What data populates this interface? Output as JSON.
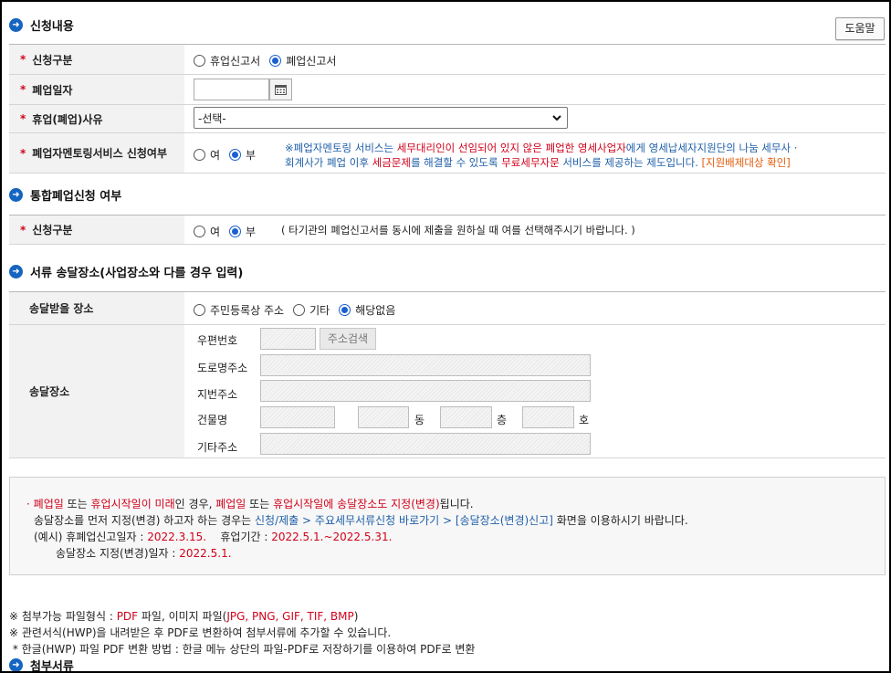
{
  "help_button": "도움말",
  "sections": {
    "application": "신청내용",
    "integrated": "통합폐업신청 여부",
    "delivery": "서류 송달장소(사업장소와 다를 경우 입력)",
    "attachments": "첨부서류"
  },
  "rows": {
    "type": {
      "label": "신청구분",
      "options": [
        "휴업신고서",
        "폐업신고서"
      ],
      "selected": "폐업신고서"
    },
    "closing_date": {
      "label": "폐업일자",
      "value": ""
    },
    "reason": {
      "label": "휴업(폐업)사유",
      "selected": "-선택-"
    },
    "mentoring": {
      "label": "폐업자멘토링서비스 신청여부",
      "options": [
        "여",
        "부"
      ],
      "selected": "부",
      "notice_line1": {
        "a": "※폐업자멘토링 서비스는 ",
        "b": "세무대리인이 선임되어 있지 않은 ",
        "c": "폐업한 영세사업자",
        "d": "에게 영세납세자지원단의 나눔 세무사 ·"
      },
      "notice_line2": {
        "a": "회계사가 폐업 이후 ",
        "b": "세금문제",
        "c": "를 해결할 수 있도록 ",
        "d": "무료세무자문",
        "e": " 서비스를 제공하는 제도입니다. ",
        "f": "[지원배제대상 확인]"
      }
    },
    "integrated_type": {
      "label": "신청구분",
      "options": [
        "여",
        "부"
      ],
      "selected": "부",
      "note": "( 타기관의 폐업신고서를 동시에 제출을 원하실 때 여를 선택해주시기 바랍니다. )"
    },
    "delivery_place": {
      "label": "송달받을 장소",
      "options": [
        "주민등록상 주소",
        "기타",
        "해당없음"
      ],
      "selected": "해당없음"
    },
    "delivery_addr": {
      "label": "송달장소",
      "zip_label": "우편번호",
      "search_btn": "주소검색",
      "road_label": "도로명주소",
      "lot_label": "지번주소",
      "building_label": "건물명",
      "dong": "동",
      "floor": "층",
      "ho": "호",
      "etc_label": "기타주소"
    }
  },
  "notice": {
    "l1": {
      "bullet": "·",
      "a": "폐업일",
      "b": " 또는 ",
      "c": "휴업시작일이 미래",
      "d": "인 경우, ",
      "e": "폐업일",
      "f": " 또는 ",
      "g": "휴업시작일에 송달장소도 지정(변경)",
      "h": "됩니다."
    },
    "l2": {
      "a": "송달장소를 먼저 지정(변경) 하고자 하는 경우는 ",
      "b": "신청/제출 > 주요세무서류신청 바로가기 > [송달장소(변경)신고]",
      "c": " 화면을 이용하시기 바랍니다."
    },
    "l3": {
      "a": "(예시) 휴폐업신고일자 : ",
      "b": "2022.3.15.",
      "c": "    휴업기간 : ",
      "d": "2022.5.1.~2022.5.31."
    },
    "l4": {
      "a": "송달장소 지정(변경)일자 : ",
      "b": "2022.5.1."
    }
  },
  "footer": {
    "f1": {
      "a": "※ 첨부가능 파일형식 : ",
      "b": "PDF",
      "c": " 파일, 이미지 파일(",
      "d": "JPG, PNG, GIF, TIF, BMP",
      "e": ")"
    },
    "f2": "※ 관련서식(HWP)을 내려받은 후 PDF로 변환하여 첨부서류에 추가할 수 있습니다.",
    "f3": " * 한글(HWP) 파일 PDF 변환 방법 : 한글 메뉴 상단의 파일-PDF로 저장하기를 이용하여 PDF로 변환"
  },
  "colors": {
    "accent_blue": "#1565c0",
    "required_red": "#d0021b",
    "link_orange": "#e35c0b"
  },
  "icons": [
    "arrow-circle-icon",
    "calendar-icon",
    "chevron-down-icon"
  ]
}
